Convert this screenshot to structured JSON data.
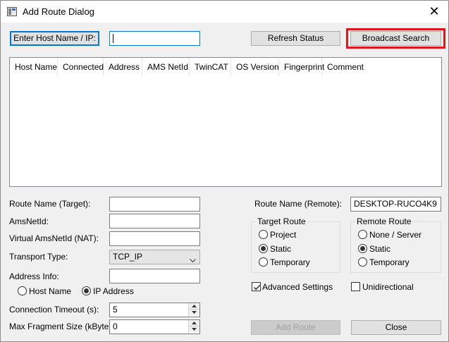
{
  "window": {
    "title": "Add Route Dialog",
    "close_glyph": "✕",
    "icon": "app-window-icon"
  },
  "top": {
    "enter_host_button": "Enter Host Name / IP:",
    "host_input_value": "",
    "refresh_button": "Refresh Status",
    "broadcast_button": "Broadcast Search"
  },
  "table": {
    "columns": [
      "Host Name",
      "Connected",
      "Address",
      "AMS NetId",
      "TwinCAT",
      "OS Version",
      "Fingerprint",
      "Comment"
    ]
  },
  "left_form": {
    "route_name_target_label": "Route Name (Target):",
    "route_name_target_value": "",
    "amsnetid_label": "AmsNetId:",
    "amsnetid_value": "",
    "virtual_amsnetid_label": "Virtual AmsNetId (NAT):",
    "virtual_amsnetid_value": "",
    "transport_type_label": "Transport Type:",
    "transport_type_value": "TCP_IP",
    "address_info_label": "Address Info:",
    "address_info_value": "",
    "radio_host_name": "Host Name",
    "radio_ip_address": "IP Address",
    "address_mode_selected": "IP Address",
    "connection_timeout_label": "Connection Timeout (s):",
    "connection_timeout_value": "5",
    "max_fragment_label": "Max Fragment Size (kByte):",
    "max_fragment_value": "0"
  },
  "right_form": {
    "route_name_remote_label": "Route Name (Remote):",
    "route_name_remote_value": "DESKTOP-RUCO4K9",
    "target_route": {
      "title": "Target Route",
      "options": [
        "Project",
        "Static",
        "Temporary"
      ],
      "selected": "Static"
    },
    "remote_route": {
      "title": "Remote Route",
      "options": [
        "None / Server",
        "Static",
        "Temporary"
      ],
      "selected": "Static"
    },
    "advanced_settings_label": "Advanced Settings",
    "advanced_settings_checked": true,
    "unidirectional_label": "Unidirectional",
    "unidirectional_checked": false,
    "add_route_button": "Add Route",
    "close_button": "Close"
  },
  "colors": {
    "highlight": "#e0161d",
    "focus": "#0078d7",
    "background": "#f0f0f0"
  }
}
